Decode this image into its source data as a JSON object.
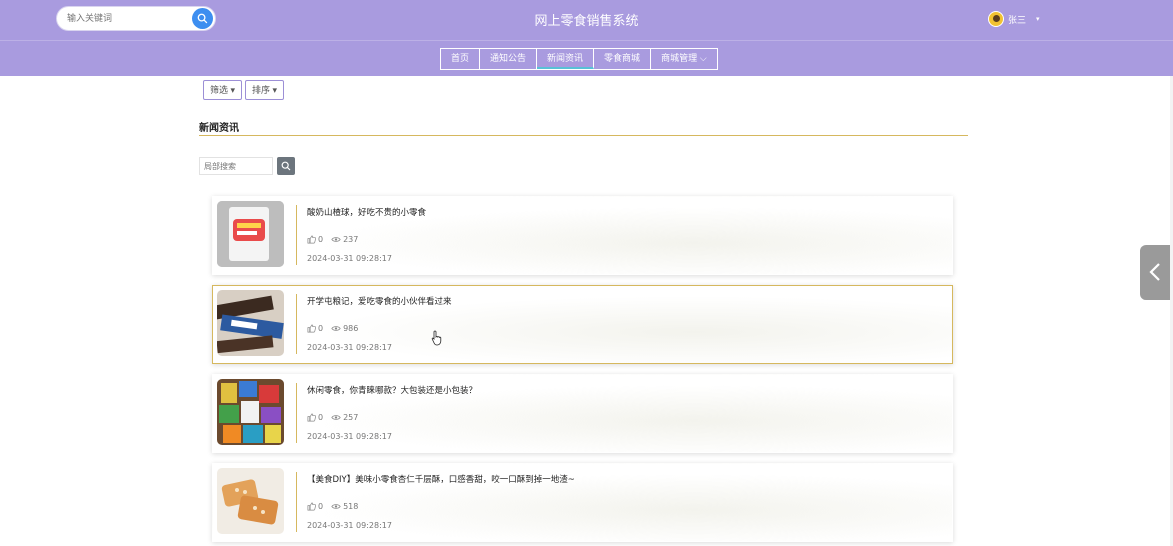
{
  "header": {
    "search_placeholder": "输入关键词",
    "title": "网上零食销售系统",
    "user_name": "张三",
    "caret": "▾"
  },
  "nav": {
    "items": [
      {
        "label": "首页"
      },
      {
        "label": "通知公告"
      },
      {
        "label": "新闻资讯",
        "active": true
      },
      {
        "label": "零食商城"
      },
      {
        "label": "商城管理 ⌵"
      }
    ]
  },
  "filters": {
    "filter_label": "筛选 ▾",
    "sort_label": "排序 ▾"
  },
  "section": {
    "title": "新闻资讯",
    "local_search_placeholder": "局部搜索"
  },
  "news": [
    {
      "title": "酸奶山楂球，好吃不贵的小零食",
      "likes": "0",
      "views": "237",
      "date": "2024-03-31 09:28:17"
    },
    {
      "title": "开学屯粮记，爱吃零食的小伙伴看过来",
      "likes": "0",
      "views": "986",
      "date": "2024-03-31 09:28:17"
    },
    {
      "title": "休闲零食，你青睐哪款？大包装还是小包装？",
      "likes": "0",
      "views": "257",
      "date": "2024-03-31 09:28:17"
    },
    {
      "title": "【美食DIY】美味小零食杏仁千层酥，口感香甜，咬一口酥到掉一地渣~",
      "likes": "0",
      "views": "518",
      "date": "2024-03-31 09:28:17"
    }
  ],
  "colors": {
    "header_bg": "#a99bdf",
    "accent_line": "#d6b85e",
    "search_button": "#3d8ef0"
  }
}
